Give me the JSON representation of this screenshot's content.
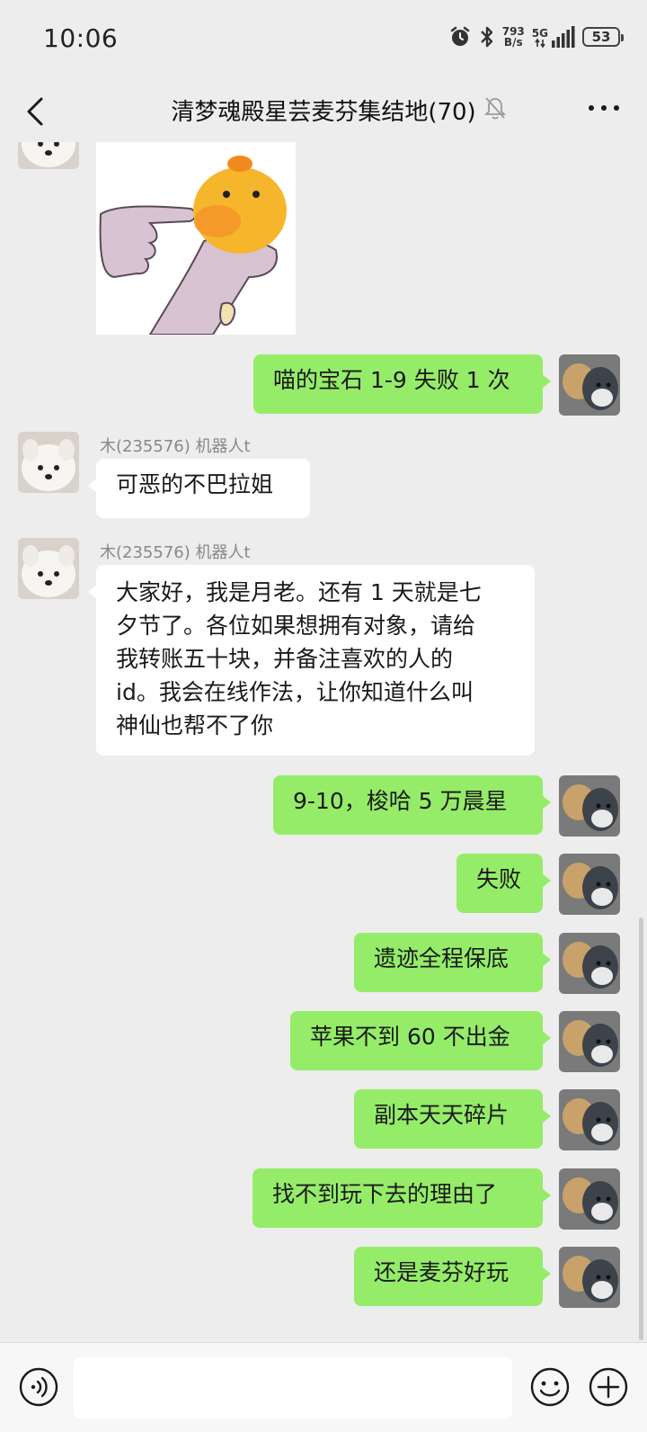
{
  "status_bar": {
    "time": "10:06",
    "net_speed_value": "793",
    "net_speed_unit": "B/s",
    "signal_label": "5G",
    "battery": "53"
  },
  "header": {
    "title": "清梦魂殿星芸麦芬集结地(70)"
  },
  "messages": [
    {
      "from": "me",
      "text": "喵的宝石 1-9 失败 1 次"
    },
    {
      "from": "other",
      "sender": "木(235576) 机器人t",
      "text": "可恶的不巴拉姐"
    },
    {
      "from": "other",
      "sender": "木(235576) 机器人t",
      "lines": [
        "大家好，我是月老。还有 1 天就是七",
        "夕节了。各位如果想拥有对象，请给",
        "我转账五十块，并备注喜欢的人的",
        "id。我会在线作法，让你知道什么叫",
        "神仙也帮不了你"
      ]
    },
    {
      "from": "me",
      "text": "9-10，梭哈 5 万晨星"
    },
    {
      "from": "me",
      "text": "失败"
    },
    {
      "from": "me",
      "text": "遗迹全程保底"
    },
    {
      "from": "me",
      "text": "苹果不到 60 不出金"
    },
    {
      "from": "me",
      "text": "副本天天碎片"
    },
    {
      "from": "me",
      "text": "找不到玩下去的理由了"
    },
    {
      "from": "me",
      "text": "还是麦芬好玩"
    }
  ],
  "colors": {
    "my_bubble": "#95ec69",
    "other_bubble": "#ffffff",
    "background": "#ededed"
  }
}
